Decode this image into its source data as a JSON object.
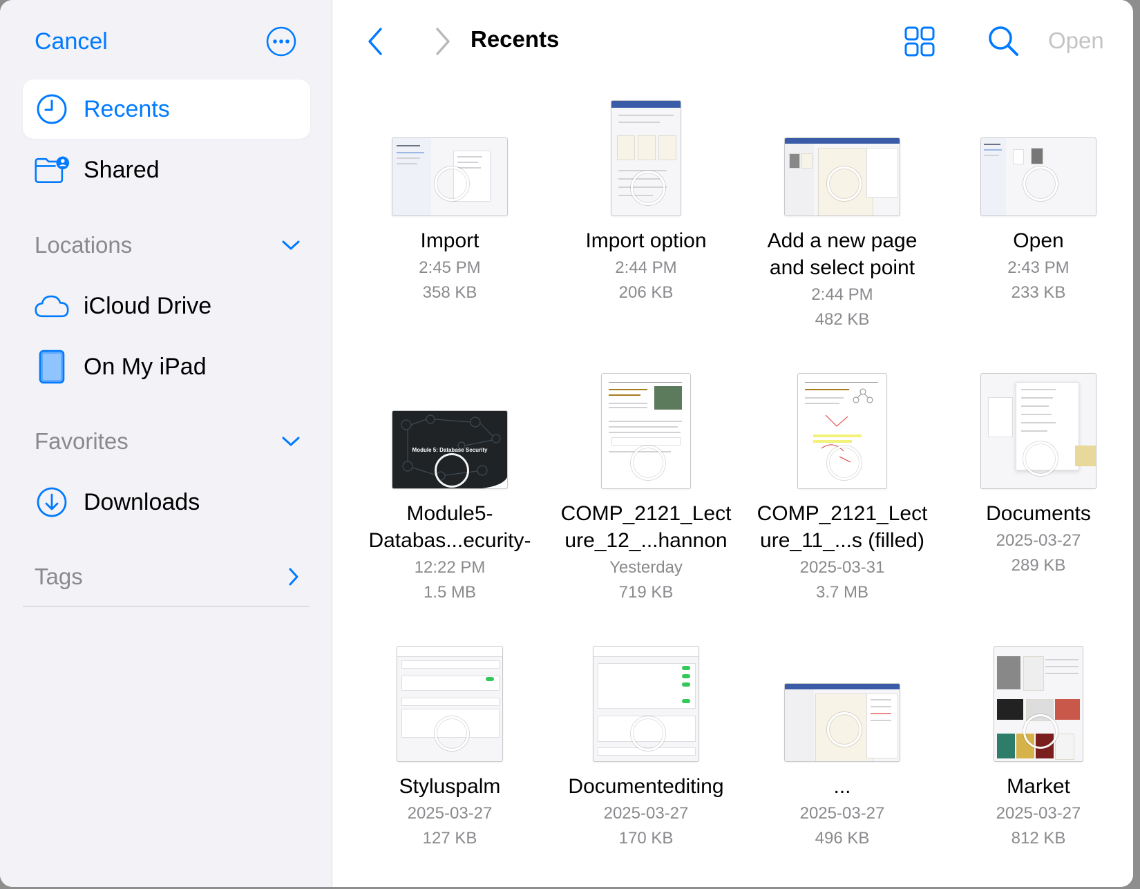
{
  "sidebar": {
    "cancel_label": "Cancel",
    "recents_label": "Recents",
    "shared_label": "Shared",
    "locations_header": "Locations",
    "icloud_label": "iCloud Drive",
    "ipad_label": "On My iPad",
    "favorites_header": "Favorites",
    "downloads_label": "Downloads",
    "tags_header": "Tags"
  },
  "toolbar": {
    "title": "Recents",
    "open_label": "Open"
  },
  "colors": {
    "accent": "#007aff",
    "secondary_text": "#8a8a8e",
    "disabled": "#c4c4c6"
  },
  "files": [
    {
      "name": "Import",
      "date": "2:45 PM",
      "size": "358 KB"
    },
    {
      "name": "Import option",
      "date": "2:44 PM",
      "size": "206 KB"
    },
    {
      "name": "Add a new page\nand select point",
      "date": "2:44 PM",
      "size": "482 KB"
    },
    {
      "name": "Open",
      "date": "2:43 PM",
      "size": "233 KB"
    },
    {
      "name": "Module5-\nDatabas...ecurity-",
      "date": "12:22 PM",
      "size": "1.5 MB",
      "caption": "Module 5: Database Security"
    },
    {
      "name": "COMP_2121_Lect\nure_12_...hannon",
      "date": "Yesterday",
      "size": "719 KB"
    },
    {
      "name": "COMP_2121_Lect\nure_11_...s (filled)",
      "date": "2025-03-31",
      "size": "3.7 MB"
    },
    {
      "name": "Documents",
      "date": "2025-03-27",
      "size": "289 KB"
    },
    {
      "name": "Styluspalm",
      "date": "2025-03-27",
      "size": "127 KB"
    },
    {
      "name": "Documentediting",
      "date": "2025-03-27",
      "size": "170 KB"
    },
    {
      "name": "...",
      "date": "2025-03-27",
      "size": "496 KB"
    },
    {
      "name": "Market",
      "date": "2025-03-27",
      "size": "812 KB"
    }
  ]
}
